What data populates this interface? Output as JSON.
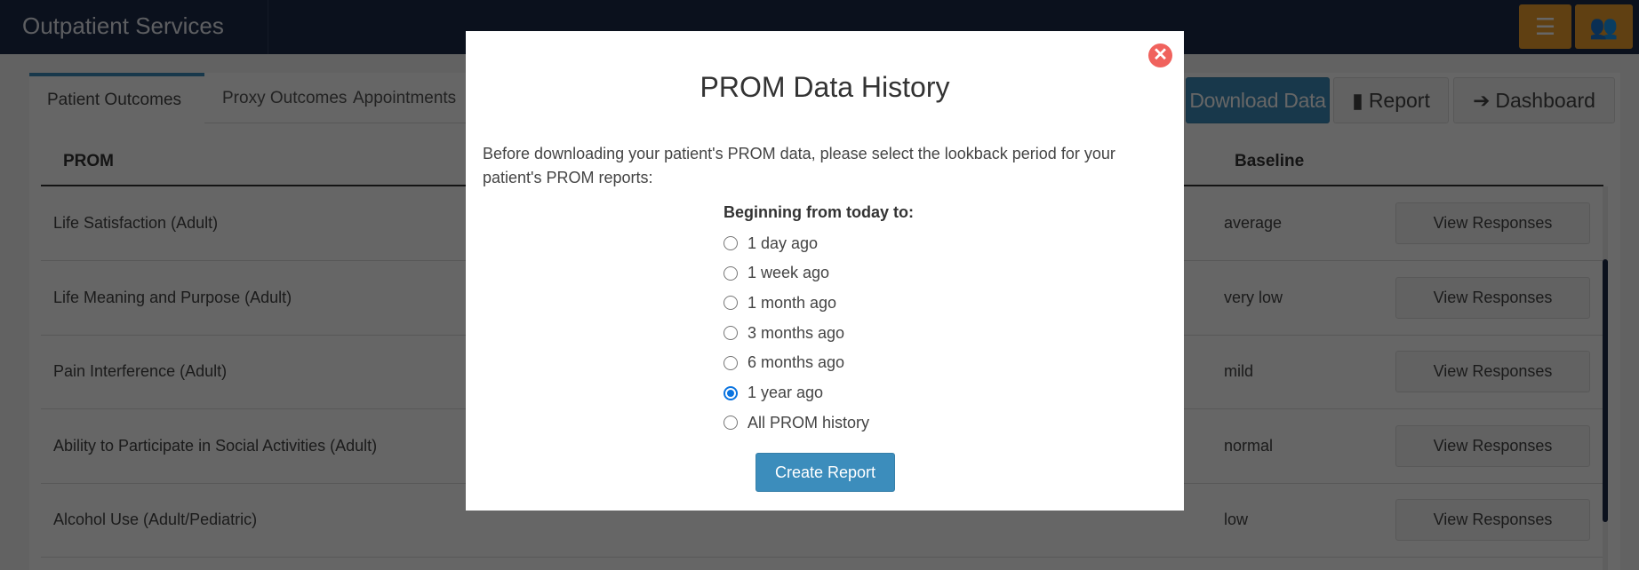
{
  "navbar": {
    "title": "Outpatient Services",
    "icons": [
      "list-icon",
      "users-icon"
    ],
    "accent": "#f0a12e"
  },
  "tabs": [
    "Patient Outcomes",
    "Proxy Outcomes",
    "Appointments"
  ],
  "toolbar": {
    "download": "Download Data",
    "report": "Report",
    "dashboard": "Dashboard"
  },
  "table": {
    "headers": {
      "prom": "PROM",
      "baseline": "Baseline"
    },
    "action_label": "View Responses",
    "rows": [
      {
        "prom": "Life Satisfaction (Adult)",
        "baseline": "average"
      },
      {
        "prom": "Life Meaning and Purpose (Adult)",
        "baseline": "very low"
      },
      {
        "prom": "Pain Interference (Adult)",
        "baseline": "mild"
      },
      {
        "prom": "Ability to Participate in Social Activities (Adult)",
        "baseline": "normal"
      },
      {
        "prom": "Alcohol Use (Adult/Pediatric)",
        "baseline": "low"
      }
    ]
  },
  "modal": {
    "title": "PROM Data History",
    "text": "Before downloading your patient's PROM data, please select the lookback period for your patient's PROM reports:",
    "label": "Beginning from today to:",
    "options": [
      "1 day ago",
      "1 week ago",
      "1 month ago",
      "3 months ago",
      "6 months ago",
      "1 year ago",
      "All PROM history"
    ],
    "selected": "1 year ago",
    "button": "Create Report"
  }
}
